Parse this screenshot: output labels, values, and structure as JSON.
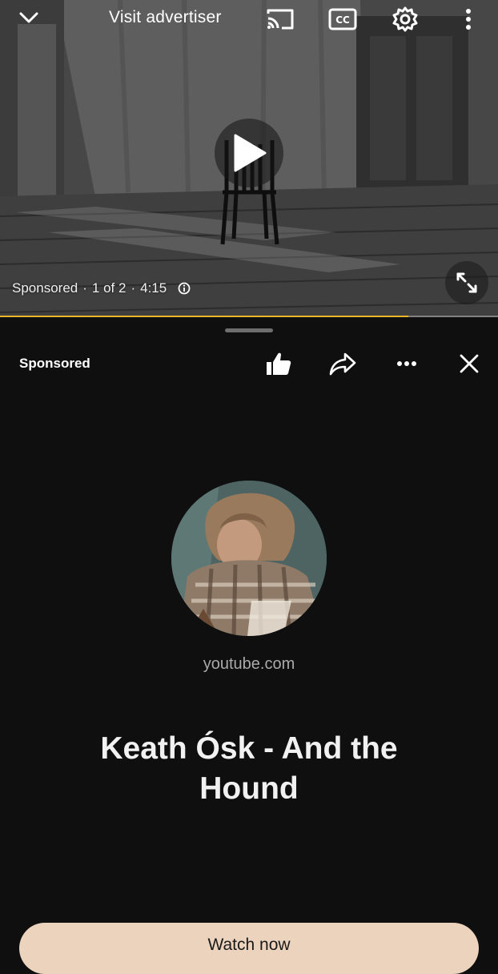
{
  "player": {
    "visit_advertiser": "Visit advertiser",
    "meta": {
      "sponsored": "Sponsored",
      "position": "1 of 2",
      "duration": "4:15"
    },
    "progress_fraction": 0.82,
    "progress_color": "#f0b62a",
    "icons": [
      "chevron-down-icon",
      "cast-icon",
      "closed-captions-icon",
      "gear-icon",
      "more-vertical-icon",
      "play-icon",
      "info-icon",
      "fullscreen-icon"
    ]
  },
  "sheet": {
    "label": "Sponsored",
    "actions": [
      "like-icon",
      "share-icon",
      "more-horizontal-icon",
      "close-icon"
    ],
    "domain": "youtube.com",
    "title": "Keath Ósk - And the Hound",
    "cta_label": "Watch now",
    "cta_color": "#ecd3bd"
  }
}
